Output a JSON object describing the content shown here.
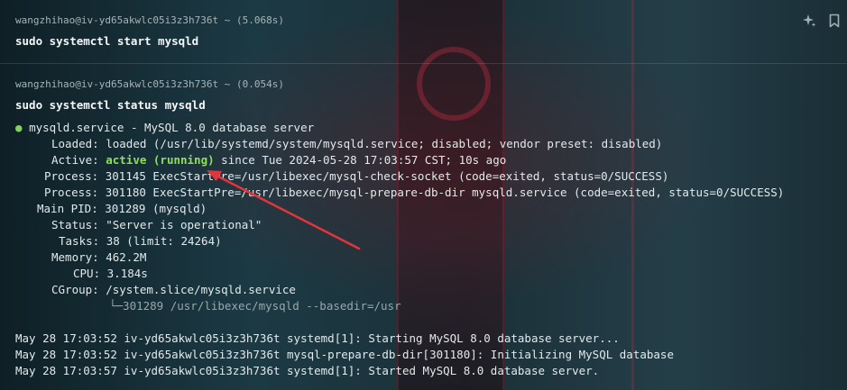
{
  "blocks": [
    {
      "prompt": "wangzhihao@iv-yd65akwlc05i3z3h736t ~ (5.068s)",
      "command": "sudo systemctl start mysqld"
    },
    {
      "prompt": "wangzhihao@iv-yd65akwlc05i3z3h736t ~ (0.054s)",
      "command": "sudo systemctl status mysqld",
      "status": {
        "bullet": "●",
        "header": "mysqld.service - MySQL 8.0 database server",
        "loaded_label": "Loaded:",
        "loaded_value": "loaded (/usr/lib/systemd/system/mysqld.service; disabled; vendor preset: disabled)",
        "active_label": "Active:",
        "active_state": "active (running)",
        "active_rest": " since Tue 2024-05-28 17:03:57 CST; 10s ago",
        "process_label": "Process:",
        "process1_value": "301145 ExecStartPre=/usr/libexec/mysql-check-socket (code=exited, status=0/SUCCESS)",
        "process2_value": "301180 ExecStartPre=/usr/libexec/mysql-prepare-db-dir mysqld.service (code=exited, status=0/SUCCESS)",
        "mainpid_label": "Main PID:",
        "mainpid_value": "301289 (mysqld)",
        "status_label": "Status:",
        "status_value": "\"Server is operational\"",
        "tasks_label": "Tasks:",
        "tasks_value": "38 (limit: 24264)",
        "memory_label": "Memory:",
        "memory_value": "462.2M",
        "cpu_label": "CPU:",
        "cpu_value": "3.184s",
        "cgroup_label": "CGroup:",
        "cgroup_value": "/system.slice/mysqld.service",
        "cgroup_child": "└─301289 /usr/libexec/mysqld --basedir=/usr"
      },
      "log": [
        "May 28 17:03:52 iv-yd65akwlc05i3z3h736t systemd[1]: Starting MySQL 8.0 database server...",
        "May 28 17:03:52 iv-yd65akwlc05i3z3h736t mysql-prepare-db-dir[301180]: Initializing MySQL database",
        "May 28 17:03:57 iv-yd65akwlc05i3z3h736t systemd[1]: Started MySQL 8.0 database server."
      ]
    }
  ],
  "icons": {
    "ai": "sparkle-icon",
    "bookmark": "bookmark-icon"
  },
  "colors": {
    "active": "#8ee05a",
    "bullet": "#7fd35a",
    "annotation_arrow": "#e0353a"
  }
}
